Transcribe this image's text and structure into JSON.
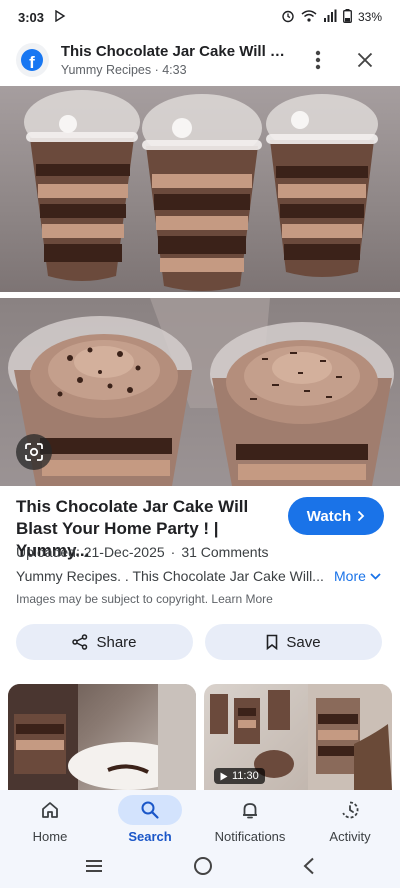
{
  "status": {
    "time": "3:03",
    "battery": "33%"
  },
  "header": {
    "title": "This Chocolate Jar Cake Will Bla...",
    "subtitle": "Yummy Recipes · 4:33"
  },
  "result": {
    "title": "This Chocolate Jar Cake Will Blast Your Home Party ! | Yummy...",
    "watch_label": "Watch",
    "uploaded": "Uploaded: 21-Dec-2025",
    "separator": "·",
    "comments": "31 Comments",
    "description": "Yummy Recipes. . This Chocolate Jar Cake Will...",
    "more_label": "More",
    "copyright": "Images may be subject to copyright. Learn More",
    "share_label": "Share",
    "save_label": "Save"
  },
  "related": {
    "duration": "11:30"
  },
  "nav": {
    "items": [
      {
        "label": "Home",
        "icon": "home-icon"
      },
      {
        "label": "Search",
        "icon": "search-icon"
      },
      {
        "label": "Notifications",
        "icon": "bell-icon"
      },
      {
        "label": "Activity",
        "icon": "activity-icon"
      }
    ],
    "active": "Search"
  },
  "colors": {
    "accent": "#1a73e8",
    "facebook": "#1877f2",
    "chip_bg": "#e8edf8",
    "nav_active_bg": "#d3e3fd"
  }
}
